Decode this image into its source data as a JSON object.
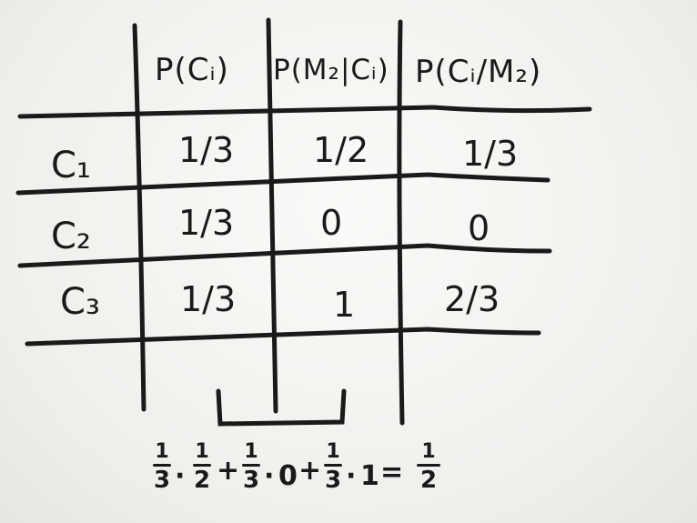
{
  "table": {
    "headers": [
      "P(Cᵢ)",
      "P(M₂|Cᵢ)",
      "P(Cᵢ/M₂)"
    ],
    "rows": [
      {
        "label": "C₁",
        "cells": [
          "1/3",
          "1/2",
          "1/3"
        ]
      },
      {
        "label": "C₂",
        "cells": [
          "1/3",
          "0",
          "0"
        ]
      },
      {
        "label": "C₃",
        "cells": [
          "1/3",
          "1",
          "2/3"
        ]
      }
    ]
  },
  "equation": {
    "terms": [
      {
        "num": "1",
        "den": "3",
        "times": "1",
        "times_den": "2"
      },
      {
        "num": "1",
        "den": "3",
        "times": "0"
      },
      {
        "num": "1",
        "den": "3",
        "times": "1"
      }
    ],
    "ops": [
      "·",
      "+",
      "·",
      "+",
      "·",
      "="
    ],
    "result_num": "1",
    "result_den": "2"
  },
  "colors": {
    "ink": "#1a1a1a",
    "board": "#f3f3f1"
  }
}
